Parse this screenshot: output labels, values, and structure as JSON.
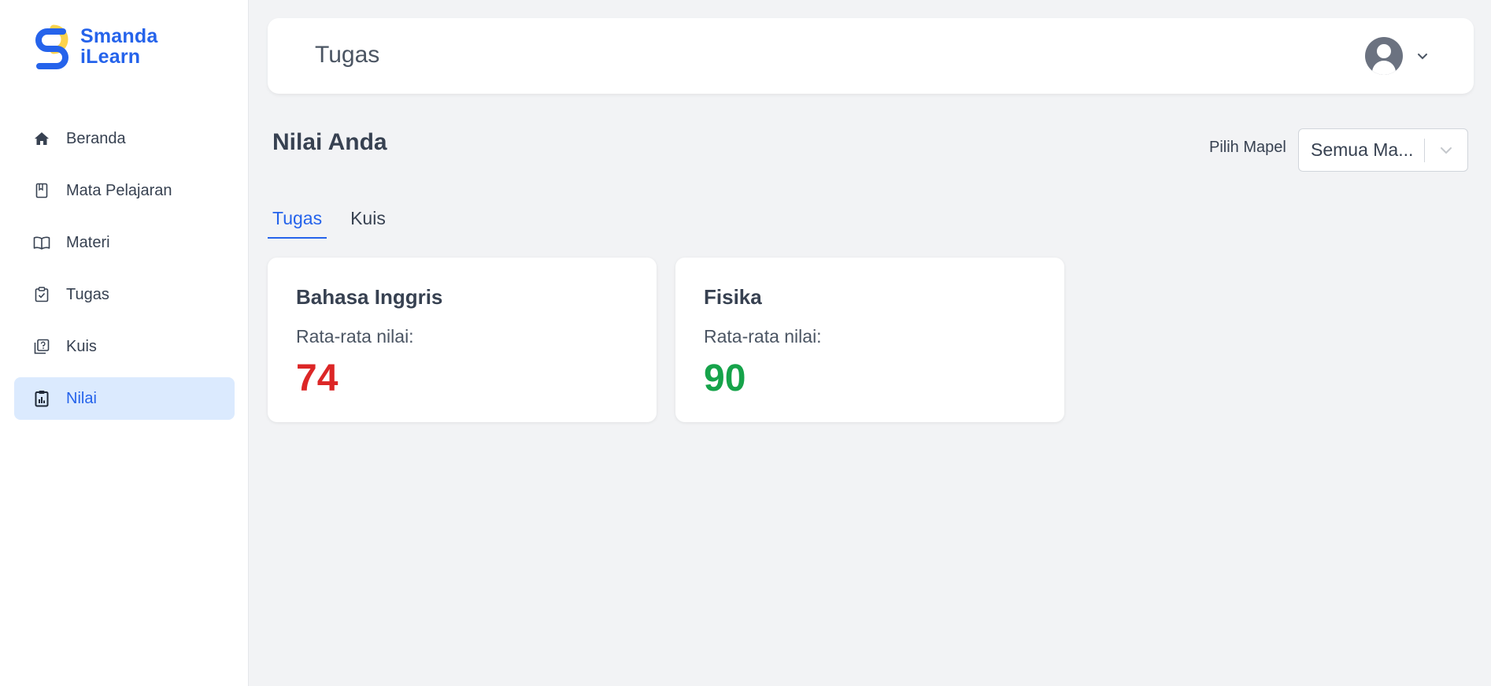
{
  "app": {
    "logo_line1": "Smanda",
    "logo_line2": "iLearn",
    "brand_color": "#2563eb",
    "accent_yellow": "#fcd34d"
  },
  "sidebar": {
    "items": [
      {
        "label": "Beranda",
        "icon": "home-icon",
        "active": false
      },
      {
        "label": "Mata Pelajaran",
        "icon": "book-icon",
        "active": false
      },
      {
        "label": "Materi",
        "icon": "open-book-icon",
        "active": false
      },
      {
        "label": "Tugas",
        "icon": "clipboard-check-icon",
        "active": false
      },
      {
        "label": "Kuis",
        "icon": "quiz-icon",
        "active": false
      },
      {
        "label": "Nilai",
        "icon": "clipboard-chart-icon",
        "active": true
      }
    ]
  },
  "header": {
    "title": "Tugas",
    "avatar_icon": "user-avatar-icon",
    "caret_icon": "chevron-down-icon"
  },
  "main": {
    "section_title": "Nilai Anda",
    "filter": {
      "label": "Pilih Mapel",
      "selected": "Semua Ma..."
    },
    "tabs": [
      {
        "label": "Tugas",
        "active": true
      },
      {
        "label": "Kuis",
        "active": false
      }
    ],
    "cards": [
      {
        "subject": "Bahasa Inggris",
        "label": "Rata-rata nilai:",
        "value": "74",
        "color": "#dc2626"
      },
      {
        "subject": "Fisika",
        "label": "Rata-rata nilai:",
        "value": "90",
        "color": "#16a34a"
      }
    ]
  }
}
